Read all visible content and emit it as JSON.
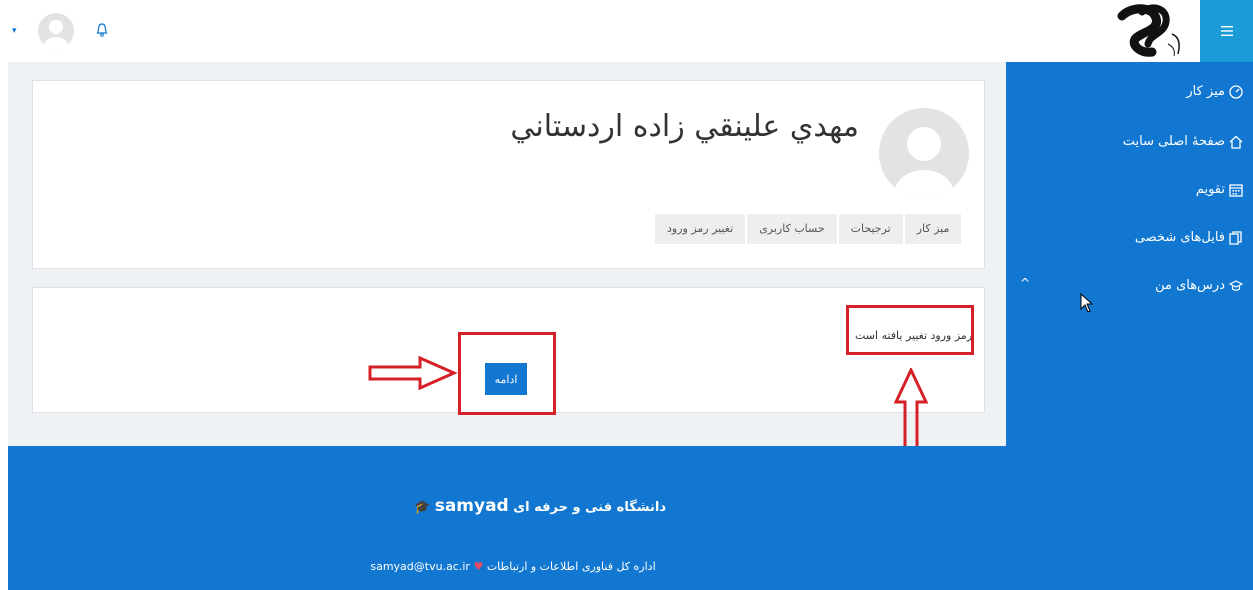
{
  "header": {
    "menu_icon": "hamburger-icon",
    "caret": "▾",
    "notification_icon": "bell-icon"
  },
  "sidebar": {
    "items": [
      {
        "label": "میز کار",
        "icon": "dashboard-icon"
      },
      {
        "label": "صفحهٔ اصلی سایت",
        "icon": "home-icon"
      },
      {
        "label": "تقویم",
        "icon": "calendar-icon"
      },
      {
        "label": "فایل‌های شخصی",
        "icon": "files-icon"
      },
      {
        "label": "درس‌های من",
        "icon": "graduation-cap-icon"
      }
    ],
    "collapse_caret": "^"
  },
  "profile": {
    "fullname": "مهدي علينقي زاده اردستاني"
  },
  "breadcrumb": [
    "میز کار",
    "ترجیحات",
    "حساب کاربری",
    "تغییر رمز ورود"
  ],
  "notice": {
    "message": "رمز ورود تغییر یافته است",
    "continue_label": "ادامه"
  },
  "footer": {
    "brand_fa": "دانشگاه فنی و حرفه ای",
    "brand_en": "samyad",
    "line_fa": "اداره کل فناوری اطلاعات و ارتباطات",
    "email": "samyad@tvu.ac.ir"
  },
  "colors": {
    "primary": "#1177d1",
    "hamburger_bg": "#1b9cd8",
    "annotation_red": "#d62027"
  }
}
